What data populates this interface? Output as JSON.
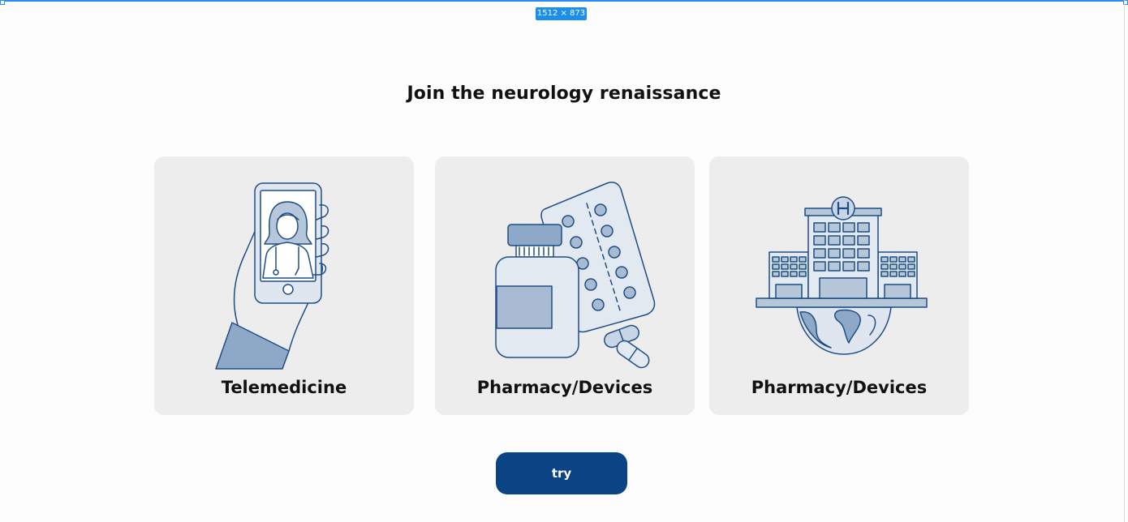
{
  "frame": {
    "size_badge": "1512 × 873"
  },
  "page": {
    "title": "Join the neurology renaissance"
  },
  "cards": [
    {
      "label": "Telemedicine",
      "icon": "phone-doctor-icon"
    },
    {
      "label": "Pharmacy/Devices",
      "icon": "pill-bottle-icon"
    },
    {
      "label": "Pharmacy/Devices",
      "icon": "hospital-globe-icon"
    }
  ],
  "cta": {
    "label": "try"
  },
  "colors": {
    "accent": "#0c4384",
    "card_bg": "#ededed",
    "illustration": "#1f4e85"
  }
}
